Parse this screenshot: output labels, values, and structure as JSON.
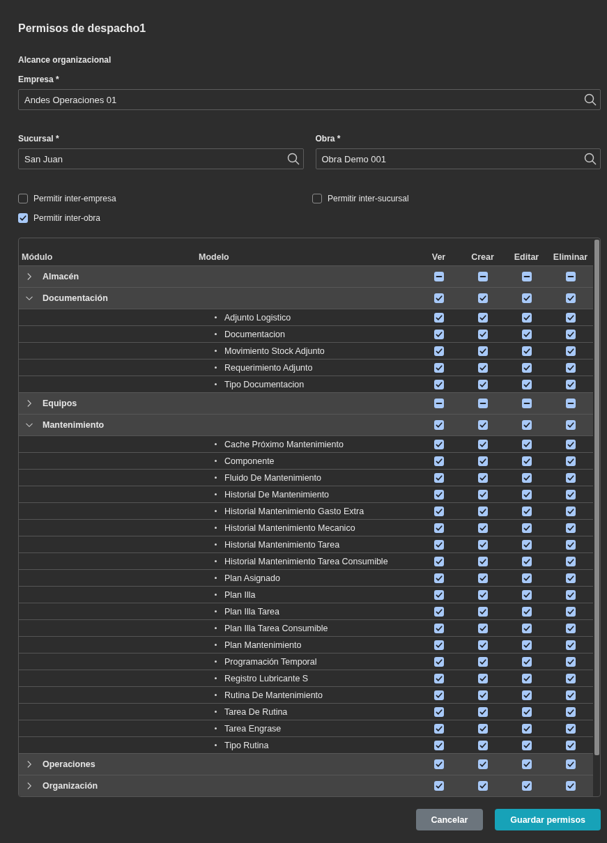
{
  "title": "Permisos de despacho1",
  "scope": {
    "heading": "Alcance organizacional",
    "empresa": {
      "label": "Empresa *",
      "value": "Andes Operaciones 01"
    },
    "sucursal": {
      "label": "Sucursal *",
      "value": "San Juan"
    },
    "obra": {
      "label": "Obra *",
      "value": "Obra Demo 001"
    }
  },
  "options": [
    {
      "label": "Permitir inter-empresa",
      "checked": false
    },
    {
      "label": "Permitir inter-sucursal",
      "checked": false
    },
    {
      "label": "Permitir inter-obra",
      "checked": true
    }
  ],
  "table": {
    "columns": [
      "Módulo",
      "Modelo",
      "Ver",
      "Crear",
      "Editar",
      "Eliminar"
    ],
    "modules": [
      {
        "name": "Almacén",
        "expanded": false,
        "permissions": [
          {
            "checked": false,
            "indeterminate": true
          },
          {
            "checked": false,
            "indeterminate": true
          },
          {
            "checked": false,
            "indeterminate": true
          },
          {
            "checked": false,
            "indeterminate": true
          }
        ]
      },
      {
        "name": "Documentación",
        "expanded": true,
        "permissions": [
          {
            "checked": true,
            "indeterminate": false
          },
          {
            "checked": true,
            "indeterminate": false
          },
          {
            "checked": true,
            "indeterminate": false
          },
          {
            "checked": true,
            "indeterminate": false
          }
        ],
        "children": [
          {
            "name": "Adjunto Logistico",
            "permissions": [
              {
                "checked": true
              },
              {
                "checked": true
              },
              {
                "checked": true
              },
              {
                "checked": true
              }
            ]
          },
          {
            "name": "Documentacion",
            "permissions": [
              {
                "checked": true
              },
              {
                "checked": true
              },
              {
                "checked": true
              },
              {
                "checked": true
              }
            ]
          },
          {
            "name": "Movimiento Stock Adjunto",
            "permissions": [
              {
                "checked": true
              },
              {
                "checked": true
              },
              {
                "checked": true
              },
              {
                "checked": true
              }
            ]
          },
          {
            "name": "Requerimiento Adjunto",
            "permissions": [
              {
                "checked": true
              },
              {
                "checked": true
              },
              {
                "checked": true
              },
              {
                "checked": true
              }
            ]
          },
          {
            "name": "Tipo Documentacion",
            "permissions": [
              {
                "checked": true
              },
              {
                "checked": true
              },
              {
                "checked": true
              },
              {
                "checked": true
              }
            ]
          }
        ]
      },
      {
        "name": "Equipos",
        "expanded": false,
        "permissions": [
          {
            "checked": false,
            "indeterminate": true
          },
          {
            "checked": false,
            "indeterminate": true
          },
          {
            "checked": false,
            "indeterminate": true
          },
          {
            "checked": false,
            "indeterminate": true
          }
        ]
      },
      {
        "name": "Mantenimiento",
        "expanded": true,
        "permissions": [
          {
            "checked": true,
            "indeterminate": false
          },
          {
            "checked": true,
            "indeterminate": false
          },
          {
            "checked": true,
            "indeterminate": false
          },
          {
            "checked": true,
            "indeterminate": false
          }
        ],
        "children": [
          {
            "name": "Cache Próximo Mantenimiento",
            "permissions": [
              {
                "checked": true
              },
              {
                "checked": true
              },
              {
                "checked": true
              },
              {
                "checked": true
              }
            ]
          },
          {
            "name": "Componente",
            "permissions": [
              {
                "checked": true
              },
              {
                "checked": true
              },
              {
                "checked": true
              },
              {
                "checked": true
              }
            ]
          },
          {
            "name": "Fluido De Mantenimiento",
            "permissions": [
              {
                "checked": true
              },
              {
                "checked": true
              },
              {
                "checked": true
              },
              {
                "checked": true
              }
            ]
          },
          {
            "name": "Historial De Mantenimiento",
            "permissions": [
              {
                "checked": true
              },
              {
                "checked": true
              },
              {
                "checked": true
              },
              {
                "checked": true
              }
            ]
          },
          {
            "name": "Historial Mantenimiento Gasto Extra",
            "permissions": [
              {
                "checked": true
              },
              {
                "checked": true
              },
              {
                "checked": true
              },
              {
                "checked": true
              }
            ]
          },
          {
            "name": "Historial Mantenimiento Mecanico",
            "permissions": [
              {
                "checked": true
              },
              {
                "checked": true
              },
              {
                "checked": true
              },
              {
                "checked": true
              }
            ]
          },
          {
            "name": "Historial Mantenimiento Tarea",
            "permissions": [
              {
                "checked": true
              },
              {
                "checked": true
              },
              {
                "checked": true
              },
              {
                "checked": true
              }
            ]
          },
          {
            "name": "Historial Mantenimiento Tarea Consumible",
            "permissions": [
              {
                "checked": true
              },
              {
                "checked": true
              },
              {
                "checked": true
              },
              {
                "checked": true
              }
            ]
          },
          {
            "name": "Plan Asignado",
            "permissions": [
              {
                "checked": true
              },
              {
                "checked": true
              },
              {
                "checked": true
              },
              {
                "checked": true
              }
            ]
          },
          {
            "name": "Plan Illa",
            "permissions": [
              {
                "checked": true
              },
              {
                "checked": true
              },
              {
                "checked": true
              },
              {
                "checked": true
              }
            ]
          },
          {
            "name": "Plan Illa Tarea",
            "permissions": [
              {
                "checked": true
              },
              {
                "checked": true
              },
              {
                "checked": true
              },
              {
                "checked": true
              }
            ]
          },
          {
            "name": "Plan Illa Tarea Consumible",
            "permissions": [
              {
                "checked": true
              },
              {
                "checked": true
              },
              {
                "checked": true
              },
              {
                "checked": true
              }
            ]
          },
          {
            "name": "Plan Mantenimiento",
            "permissions": [
              {
                "checked": true
              },
              {
                "checked": true
              },
              {
                "checked": true
              },
              {
                "checked": true
              }
            ]
          },
          {
            "name": "Programación Temporal",
            "permissions": [
              {
                "checked": true
              },
              {
                "checked": true
              },
              {
                "checked": true
              },
              {
                "checked": true
              }
            ]
          },
          {
            "name": "Registro Lubricante S",
            "permissions": [
              {
                "checked": true
              },
              {
                "checked": true
              },
              {
                "checked": true
              },
              {
                "checked": true
              }
            ]
          },
          {
            "name": "Rutina De Mantenimiento",
            "permissions": [
              {
                "checked": true
              },
              {
                "checked": true
              },
              {
                "checked": true
              },
              {
                "checked": true
              }
            ]
          },
          {
            "name": "Tarea De Rutina",
            "permissions": [
              {
                "checked": true
              },
              {
                "checked": true
              },
              {
                "checked": true
              },
              {
                "checked": true
              }
            ]
          },
          {
            "name": "Tarea Engrase",
            "permissions": [
              {
                "checked": true
              },
              {
                "checked": true
              },
              {
                "checked": true
              },
              {
                "checked": true
              }
            ]
          },
          {
            "name": "Tipo Rutina",
            "permissions": [
              {
                "checked": true
              },
              {
                "checked": true
              },
              {
                "checked": true
              },
              {
                "checked": true
              }
            ]
          }
        ]
      },
      {
        "name": "Operaciones",
        "expanded": false,
        "permissions": [
          {
            "checked": true,
            "indeterminate": false
          },
          {
            "checked": true,
            "indeterminate": false
          },
          {
            "checked": true,
            "indeterminate": false
          },
          {
            "checked": true,
            "indeterminate": false
          }
        ]
      },
      {
        "name": "Organización",
        "expanded": false,
        "permissions": [
          {
            "checked": true,
            "indeterminate": false
          },
          {
            "checked": true,
            "indeterminate": false
          },
          {
            "checked": true,
            "indeterminate": false
          },
          {
            "checked": true,
            "indeterminate": false
          }
        ]
      }
    ]
  },
  "actions": [
    {
      "label": "Cancelar",
      "kind": "secondary"
    },
    {
      "label": "Guardar permisos",
      "kind": "primary"
    }
  ]
}
